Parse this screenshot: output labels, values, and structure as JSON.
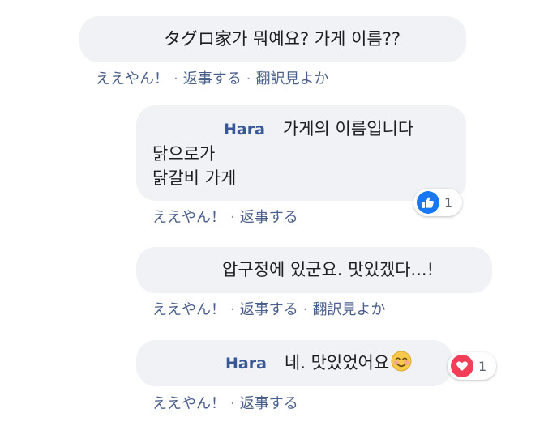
{
  "comments": [
    {
      "text": "タグロ家가 뭐예요? 가게 이름??",
      "actions": {
        "like": "ええやん！",
        "reply": "返事する",
        "translate": "翻訳見よか"
      }
    },
    {
      "author": "Hara",
      "text_line1": "가게의 이름입니다",
      "text_line2": "닭으로가",
      "text_line3": "닭갈비 가게",
      "reaction": {
        "icon": "thumbs-up-icon",
        "count": "1"
      },
      "actions": {
        "like": "ええやん！",
        "reply": "返事する"
      }
    },
    {
      "text": "압구정에 있군요. 맛있겠다...!",
      "actions": {
        "like": "ええやん！",
        "reply": "返事する",
        "translate": "翻訳見よか"
      }
    },
    {
      "author": "Hara",
      "text": "네. 맛있었어요",
      "emoji": "smiling-face-icon",
      "reaction": {
        "icon": "heart-icon",
        "count": "1"
      },
      "actions": {
        "like": "ええやん！",
        "reply": "返事する"
      }
    }
  ],
  "separator": "·",
  "colors": {
    "bubble": "#f0f2f5",
    "author": "#385898",
    "action_link": "#4b5f8c",
    "like_blue": "#1877f2",
    "love_red": "#f33e58"
  }
}
